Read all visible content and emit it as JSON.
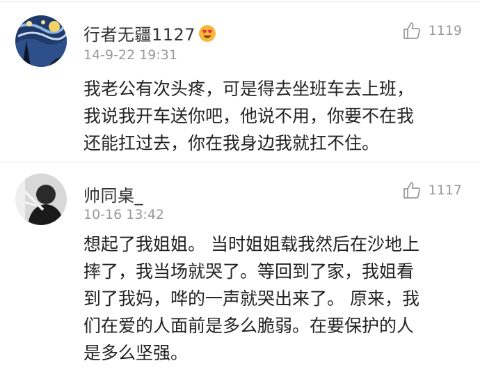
{
  "comments": [
    {
      "username": "行者无疆1127",
      "badge_icon": "heart-eyes-emoji-icon",
      "timestamp": "14-9-22 19:31",
      "likes": "1119",
      "lines": [
        "我老公有次头疼，可是得去坐班车去上班，",
        "我说我开车送你吧，他说不用，你要不在我",
        "还能扛过去，你在我身边我就扛不住。"
      ]
    },
    {
      "username": "帅同桌_",
      "timestamp": "10-16 13:42",
      "likes": "1117",
      "lines": [
        "想起了我姐姐。 当时姐姐载我然后在沙地上",
        "摔了，我当场就哭了。等回到了家，我姐看",
        "到了我妈，哗的一声就哭出来了。 原来，我",
        "们在爱的人面前是多么脆弱。在要保护的人",
        "是多么坚强。"
      ]
    }
  ],
  "colors": {
    "name": "#333333",
    "meta": "#999999",
    "text": "#222222",
    "divider": "#e6e6e6"
  }
}
